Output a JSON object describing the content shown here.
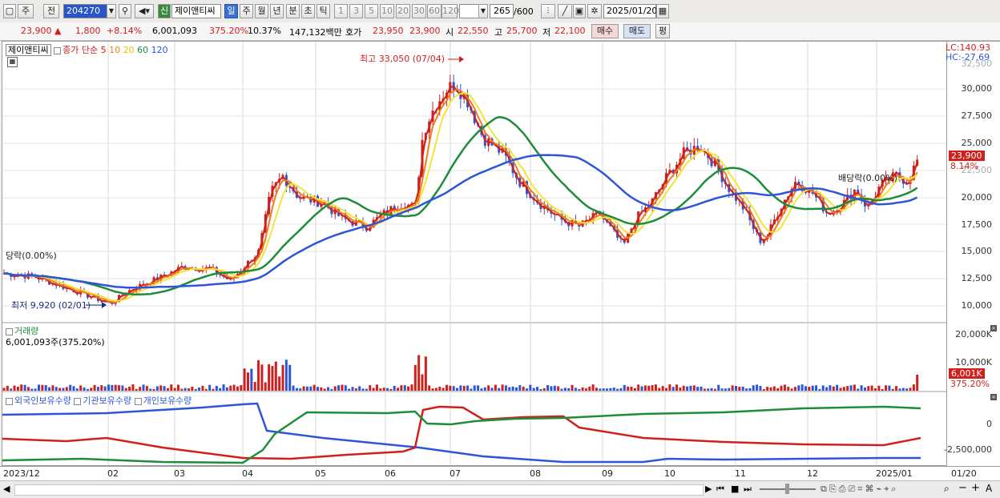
{
  "toolbar": {
    "market_btn": "주",
    "prev_btn": "전",
    "code_value": "204270",
    "new_btn": "신",
    "stock_name": "제이앤티씨",
    "period_tabs": [
      "일",
      "주",
      "월",
      "년",
      "분",
      "초",
      "틱"
    ],
    "numbers": [
      "1",
      "3",
      "5",
      "10",
      "20",
      "30",
      "60",
      "120"
    ],
    "count_value": "265",
    "count_max": "/600",
    "date_value": "2025/01/20"
  },
  "pricebar": {
    "price": "23,900",
    "arrow": "▲",
    "change": "1,800",
    "change_pct": "+8.14%",
    "volume": "6,001,093",
    "vol_ratio": "375.20%",
    "turnover": "10.37%",
    "amount": "147,132백만",
    "ask_label": "호가",
    "ask1": "23,950",
    "ask2": "23,900",
    "open_label": "시",
    "open": "22,550",
    "high_label": "고",
    "high": "25,700",
    "low_label": "저",
    "low": "22,100",
    "buy_btn": "매수",
    "sell_btn": "매도",
    "avg_btn": "평"
  },
  "price_panel": {
    "legend_name": "제이앤티씨",
    "legend_series": "종가 단순",
    "ma_periods": [
      "5",
      "10",
      "20",
      "60",
      "120"
    ],
    "ma_colors": [
      "#d0201c",
      "#f07d1a",
      "#f2e43a",
      "#1e8c3a",
      "#2e55d8"
    ],
    "high_note": "최고 33,050 (07/04)",
    "low_note": "최저 9,920 (02/01)",
    "left_note": "당락(0.00%)",
    "right_note": "배당락(0.00%)",
    "lc": "LC:140.93",
    "hc": "HC:-27.69",
    "yticks": [
      "32,500",
      "30,000",
      "27,500",
      "25,000",
      "22,500",
      "20,000",
      "17,500",
      "15,000",
      "12,500",
      "10,000"
    ],
    "last_price_tag": "23,900",
    "last_pct_tag": "8.14%"
  },
  "volume_panel": {
    "title": "거래량",
    "value": "6,001,093주(375.20%)",
    "yticks": [
      "20,000K",
      "10,000K"
    ],
    "last_tag": "6,001K",
    "last_pct": "375.20%"
  },
  "holdings_panel": {
    "series": [
      "외국인보유수량",
      "기관보유수량",
      "개인보유수량"
    ],
    "colors": [
      "#2e55d8",
      "#d0201c",
      "#1e8c3a"
    ],
    "yticks": [
      "0",
      "-2,500,000"
    ]
  },
  "xaxis": {
    "labels": [
      "2023/12",
      "02",
      "03",
      "04",
      "05",
      "06",
      "07",
      "08",
      "09",
      "10",
      "11",
      "12",
      "2025/01"
    ],
    "right_label": "01/20"
  }
}
